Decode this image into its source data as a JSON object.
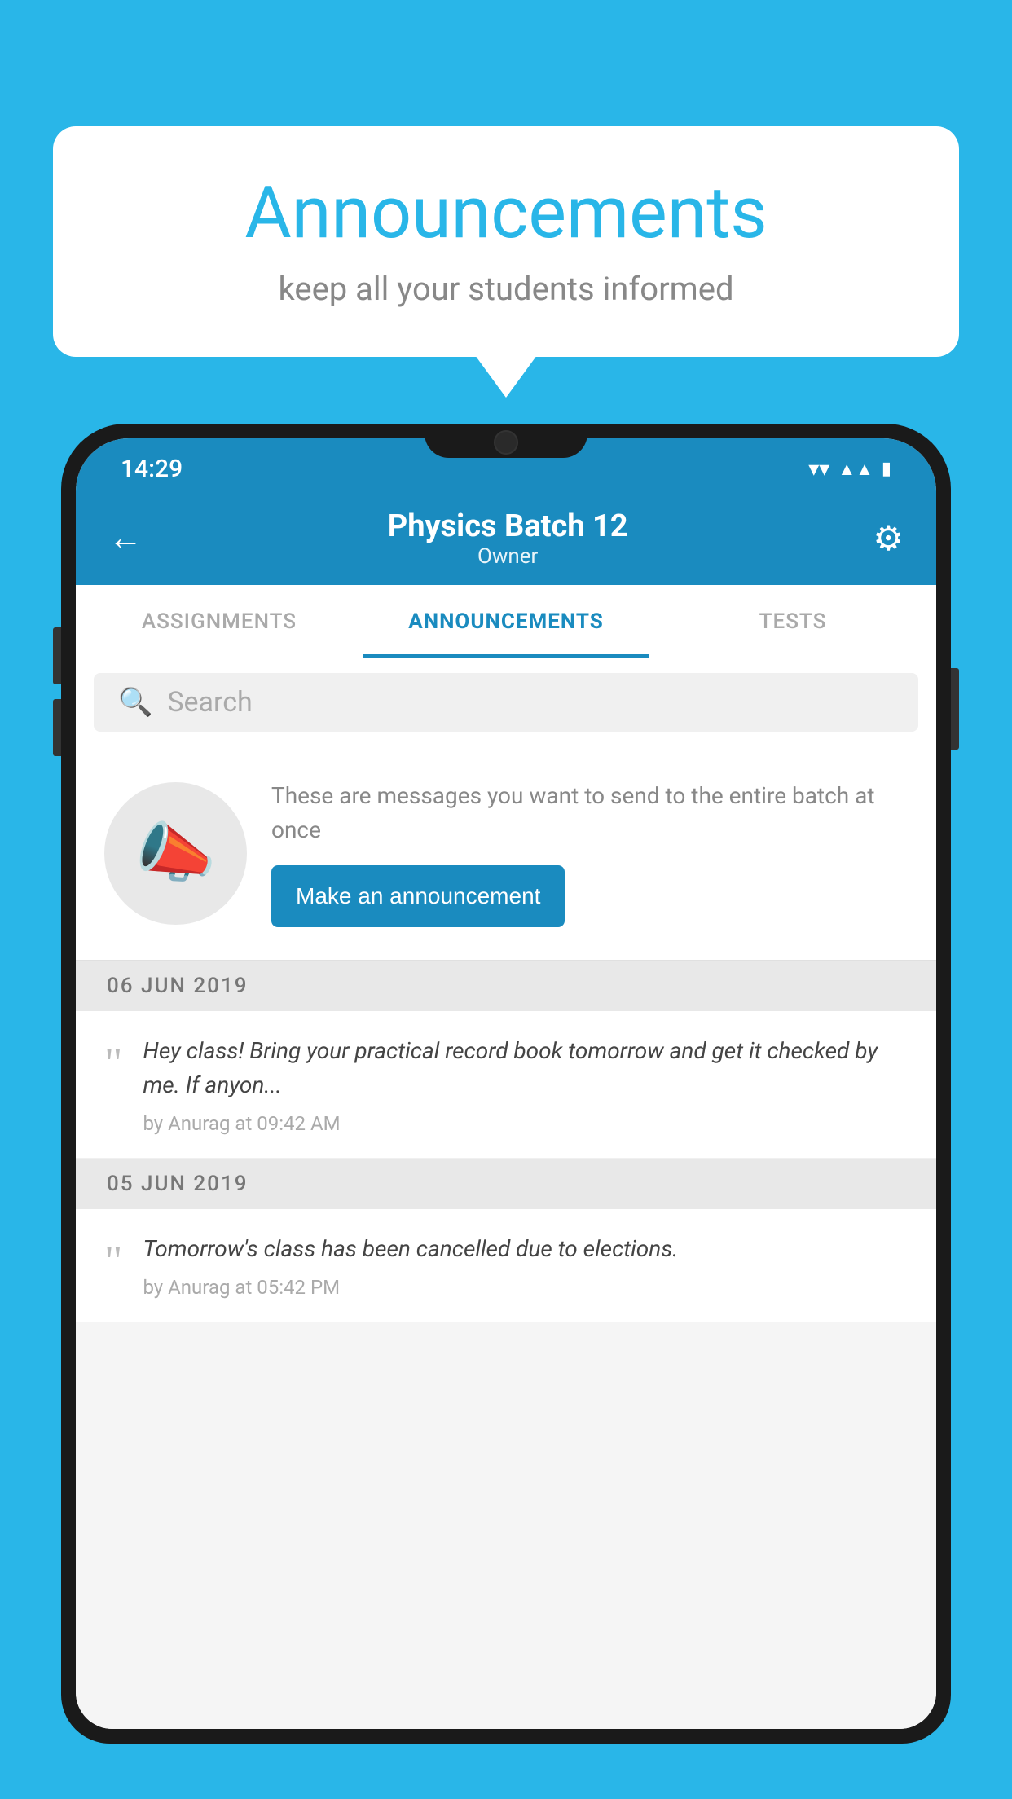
{
  "page": {
    "background_color": "#29b6e8"
  },
  "speech_bubble": {
    "title": "Announcements",
    "subtitle": "keep all your students informed"
  },
  "phone": {
    "status_bar": {
      "time": "14:29"
    },
    "app_bar": {
      "title": "Physics Batch 12",
      "subtitle": "Owner",
      "back_label": "←",
      "settings_label": "⚙"
    },
    "tabs": [
      {
        "label": "ASSIGNMENTS",
        "active": false
      },
      {
        "label": "ANNOUNCEMENTS",
        "active": true
      },
      {
        "label": "TESTS",
        "active": false
      }
    ],
    "search": {
      "placeholder": "Search"
    },
    "announcement_prompt": {
      "description": "These are messages you want to send to the entire batch at once",
      "button_label": "Make an announcement"
    },
    "announcements": [
      {
        "date": "06  JUN  2019",
        "message": "Hey class! Bring your practical record book tomorrow and get it checked by me. If anyon...",
        "author": "by Anurag at 09:42 AM"
      },
      {
        "date": "05  JUN  2019",
        "message": "Tomorrow's class has been cancelled due to elections.",
        "author": "by Anurag at 05:42 PM"
      }
    ]
  }
}
